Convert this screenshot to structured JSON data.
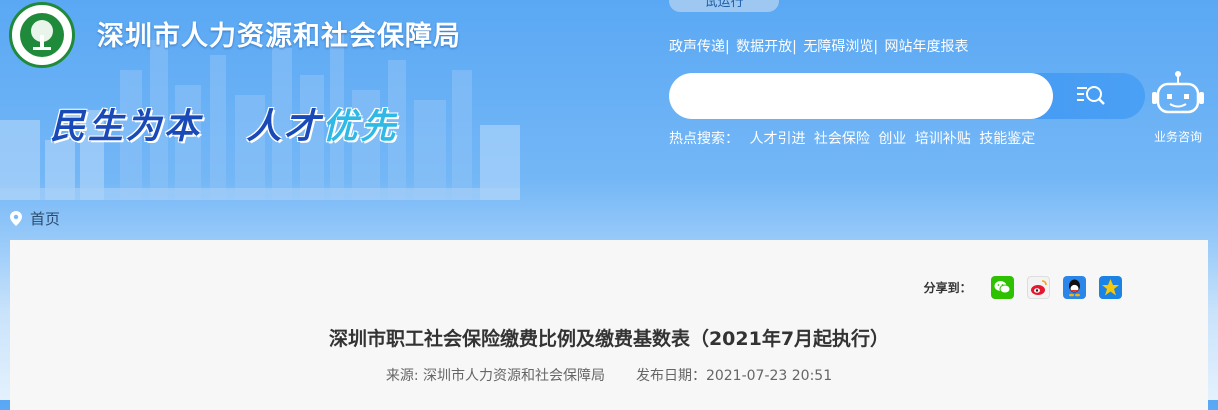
{
  "header": {
    "site_title": "深圳市人力资源和社会保障局",
    "slogan_part1": "民生为本",
    "slogan_part2": "人才",
    "slogan_part3": "优先",
    "trial_badge": "试运行",
    "top_links": [
      "政声传递",
      "数据开放",
      "无障碍浏览",
      "网站年度报表"
    ],
    "hot_search_label": "热点搜索：",
    "hot_search_items": [
      "人才引进",
      "社会保险",
      "创业",
      "培训补贴",
      "技能鉴定"
    ],
    "consult_label": "业务咨询",
    "icons": {
      "logo": "bureau-logo",
      "search": "search-icon",
      "consult": "robot-icon"
    }
  },
  "breadcrumb": {
    "home": "首页"
  },
  "article": {
    "share_label": "分享到：",
    "share_targets": [
      "wechat-icon",
      "weibo-icon",
      "qq-icon",
      "qzone-icon"
    ],
    "title": "深圳市职工社会保险缴费比例及缴费基数表（2021年7月起执行）",
    "source_label": "来源:",
    "source": "深圳市人力资源和社会保障局",
    "publish_label": "发布日期：",
    "publish_date": "2021-07-23 20:51"
  },
  "colors": {
    "brand_blue": "#3a8df0",
    "slogan_blue": "#1a49b8",
    "logo_green": "#1f8a3a"
  }
}
